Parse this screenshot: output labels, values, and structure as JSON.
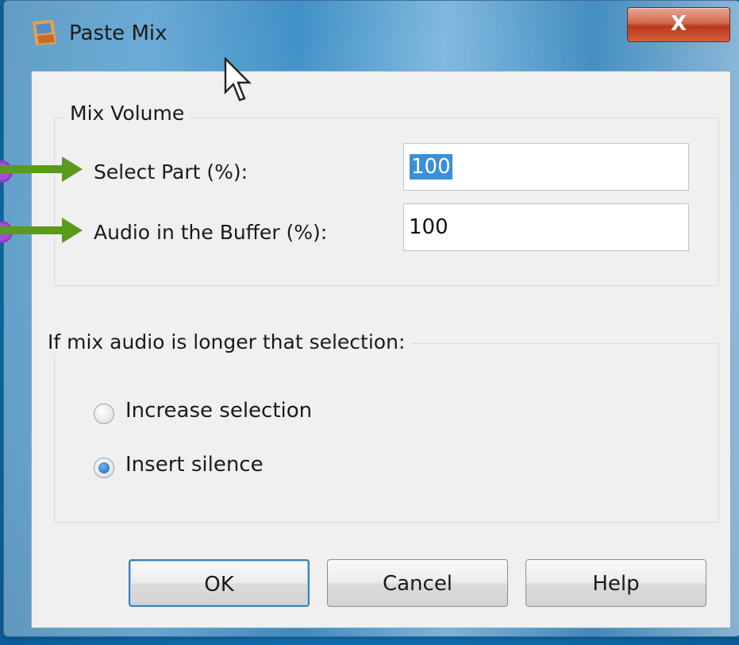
{
  "window": {
    "title": "Paste Mix",
    "close_label": "X"
  },
  "mix_volume": {
    "legend": "Mix Volume",
    "select_part_label": "Select Part (%):",
    "select_part_value": "100",
    "buffer_label": "Audio in the Buffer (%):",
    "buffer_value": "100"
  },
  "mix_longer": {
    "legend": "If mix audio is longer that selection:",
    "options": [
      {
        "label": "Increase selection",
        "checked": false
      },
      {
        "label": "Insert silence",
        "checked": true
      }
    ]
  },
  "buttons": {
    "ok": "OK",
    "cancel": "Cancel",
    "help": "Help"
  },
  "colors": {
    "arrow": "#5a9a1c",
    "marker": "#a14fd8",
    "close": "#c2472a"
  }
}
